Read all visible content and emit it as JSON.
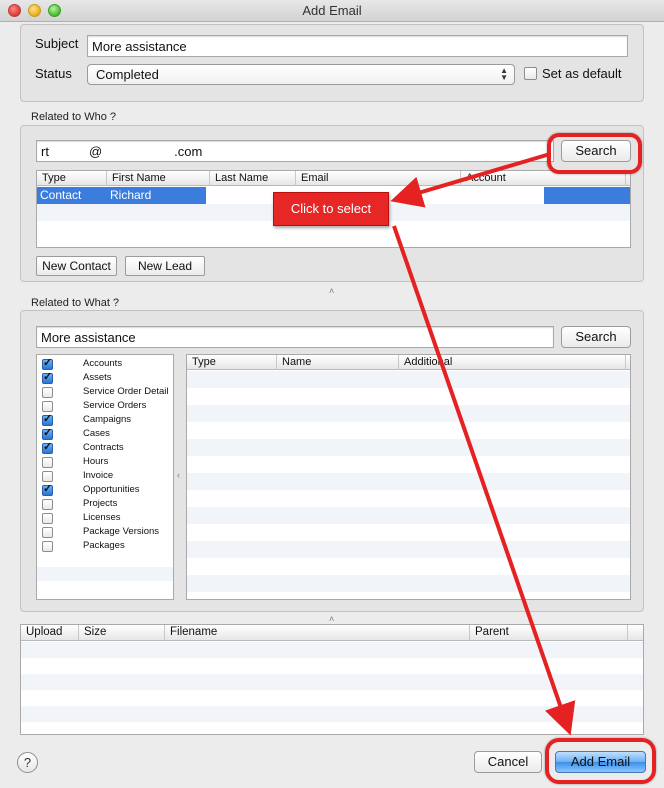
{
  "window": {
    "title": "Add Email"
  },
  "subject": {
    "label": "Subject",
    "value": "More assistance"
  },
  "status": {
    "label": "Status",
    "selected": "Completed",
    "set_default_label": "Set as default",
    "set_default_checked": false
  },
  "related_who": {
    "title": "Related to Who ?",
    "search_value_prefix": "rt",
    "search_value_at": "@",
    "search_value_domain": ".com",
    "search_button": "Search",
    "columns": [
      "Type",
      "First Name",
      "Last Name",
      "Email",
      "Account"
    ],
    "rows": [
      {
        "type": "Contact",
        "first_name": "Richard",
        "last_name": "",
        "email": "",
        "account": ""
      }
    ],
    "new_contact_button": "New Contact",
    "new_lead_button": "New Lead"
  },
  "related_what": {
    "title": "Related to What ?",
    "search_value": "More assistance",
    "search_button": "Search",
    "categories": [
      {
        "label": "Accounts",
        "checked": true
      },
      {
        "label": "Assets",
        "checked": true
      },
      {
        "label": "Service Order Detail",
        "checked": false
      },
      {
        "label": "Service Orders",
        "checked": false
      },
      {
        "label": "Campaigns",
        "checked": true
      },
      {
        "label": "Cases",
        "checked": true
      },
      {
        "label": "Contracts",
        "checked": true
      },
      {
        "label": "Hours",
        "checked": false
      },
      {
        "label": "Invoice",
        "checked": false
      },
      {
        "label": "Opportunities",
        "checked": true
      },
      {
        "label": "Projects",
        "checked": false
      },
      {
        "label": "Licenses",
        "checked": false
      },
      {
        "label": "Package Versions",
        "checked": false
      },
      {
        "label": "Packages",
        "checked": false
      }
    ],
    "columns": [
      "Type",
      "Name",
      "Additional"
    ]
  },
  "attachments": {
    "columns": [
      "Upload",
      "Size",
      "Filename",
      "Parent"
    ]
  },
  "footer": {
    "help": "?",
    "cancel_button": "Cancel",
    "add_button": "Add Email"
  },
  "annotation": {
    "callout_text": "Click to select",
    "color": "#e52121"
  }
}
